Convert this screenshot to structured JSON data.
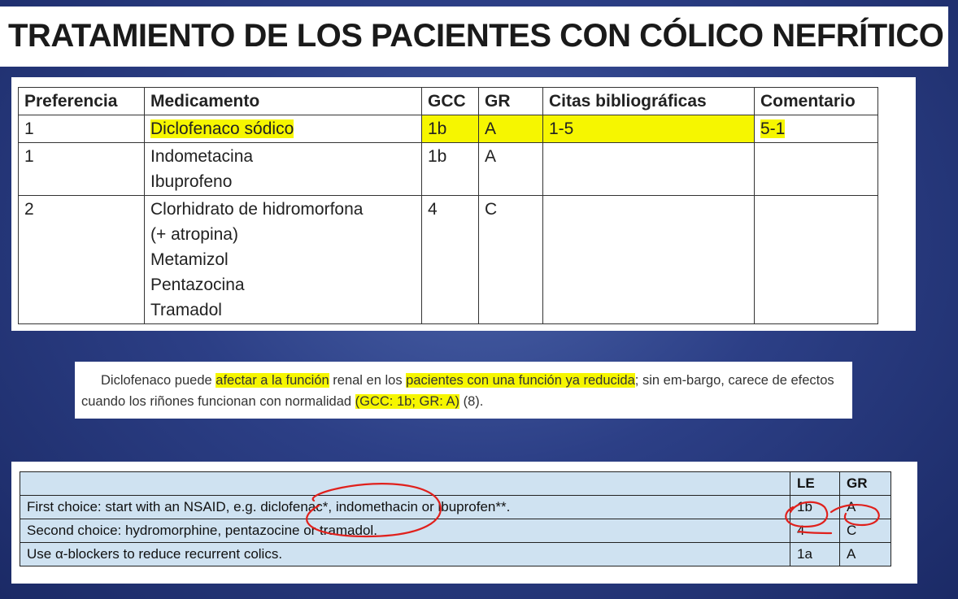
{
  "title": "TRATAMIENTO DE LOS PACIENTES CON CÓLICO NEFRÍTICO",
  "table_es": {
    "headers": [
      "Preferencia",
      "Medicamento",
      "GCC",
      "GR",
      "Citas bibliográficas",
      "Comentario"
    ],
    "rows": [
      {
        "preferencia": "1",
        "medicamentos": [
          "Diclofenaco sódico"
        ],
        "gcc": "1b",
        "gr": "A",
        "citas": "1-5",
        "comentario": "5-1"
      },
      {
        "preferencia": "1",
        "medicamentos": [
          "Indometacina",
          "Ibuprofeno"
        ],
        "gcc": "1b",
        "gr": "A",
        "citas": "",
        "comentario": ""
      },
      {
        "preferencia": "2",
        "medicamentos": [
          "Clorhidrato de hidromorfona",
          "(+ atropina)",
          "Metamizol",
          "Pentazocina",
          "Tramadol"
        ],
        "gcc": "4",
        "gr": "C",
        "citas": "",
        "comentario": ""
      }
    ],
    "highlight_color": "#f6f600"
  },
  "note": {
    "part1": "Diclofenaco puede ",
    "hl1": "afectar a la función",
    "part2": " renal en los ",
    "hl2": "pacientes con una función ya reducida",
    "part3": "; sin em-bargo, carece de efectos cuando los riñones funcionan con normalidad ",
    "hl3": "(GCC: 1b; GR: A)",
    "part4": " (8)."
  },
  "table_en": {
    "headers": [
      "",
      "LE",
      "GR"
    ],
    "rows": [
      {
        "text": "First choice: start with an NSAID, e.g. diclofenac*, indomethacin or ibuprofen**.",
        "le": "1b",
        "gr": "A"
      },
      {
        "text": "Second choice: hydromorphine, pentazocine or tramadol.",
        "le": "4",
        "gr": "C"
      },
      {
        "text": "Use α-blockers to reduce recurrent colics.",
        "le": "1a",
        "gr": "A"
      }
    ],
    "cell_color": "#cfe2f1",
    "annotation_color": "#e0201c"
  }
}
